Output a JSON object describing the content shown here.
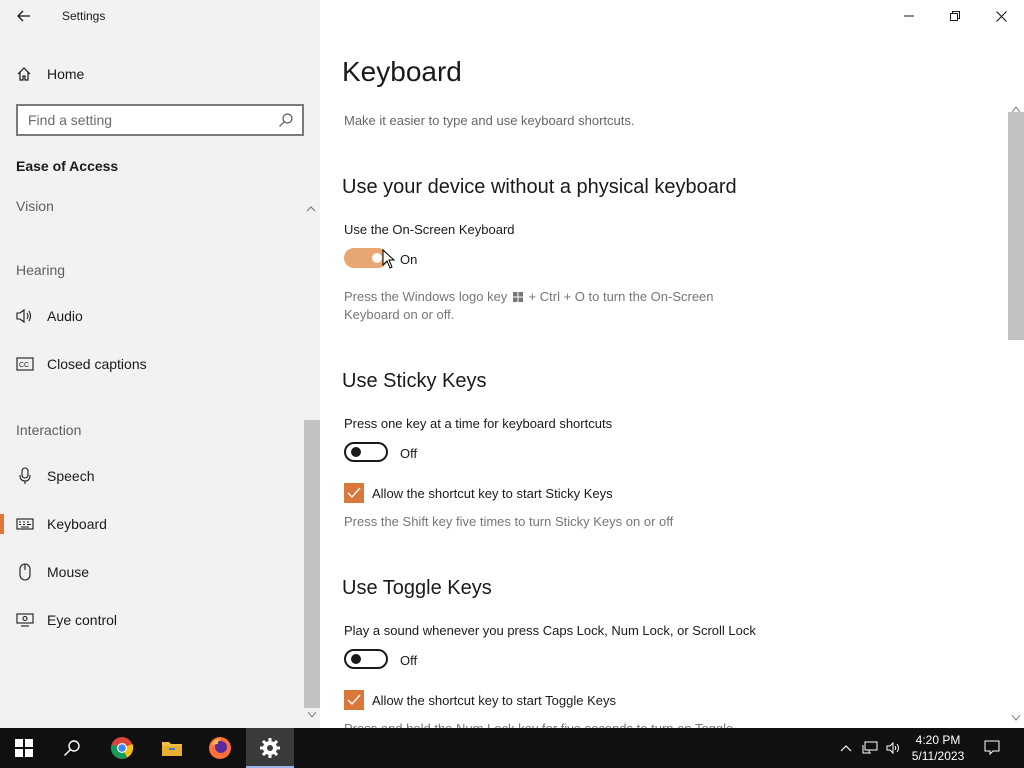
{
  "app": {
    "title": "Settings"
  },
  "sidebar": {
    "home_label": "Home",
    "search_placeholder": "Find a setting",
    "section_title": "Ease of Access",
    "groups": {
      "vision": "Vision",
      "hearing": "Hearing",
      "interaction": "Interaction"
    },
    "items": {
      "audio": "Audio",
      "closed_captions": "Closed captions",
      "speech": "Speech",
      "keyboard": "Keyboard",
      "mouse": "Mouse",
      "eye_control": "Eye control"
    },
    "active_item": "Keyboard"
  },
  "main": {
    "page_title": "Keyboard",
    "description": "Make it easier to type and use keyboard shortcuts.",
    "sections": {
      "osk": {
        "heading": "Use your device without a physical keyboard",
        "label": "Use the On-Screen Keyboard",
        "state": "On",
        "note_prefix": "Press the Windows logo key",
        "note_suffix": "+ Ctrl + O to turn the On-Screen Keyboard on or off."
      },
      "sticky": {
        "heading": "Use Sticky Keys",
        "label": "Press one key at a time for keyboard shortcuts",
        "state": "Off",
        "checkbox_label": "Allow the shortcut key to start Sticky Keys",
        "note": "Press the Shift key five times to turn Sticky Keys on or off"
      },
      "toggle": {
        "heading": "Use Toggle Keys",
        "label": "Play a sound whenever you press Caps Lock, Num Lock, or Scroll Lock",
        "state": "Off",
        "checkbox_label": "Allow the shortcut key to start Toggle Keys",
        "note": "Press and hold the Num Lock key for five seconds to turn on Toggle"
      }
    }
  },
  "taskbar": {
    "time": "4:20 PM",
    "date": "5/11/2023"
  },
  "colors": {
    "accent": "#e0763a",
    "toggle_on": "#e8a673",
    "checkbox": "#d8783a",
    "taskbar": "#101010"
  },
  "icons": {
    "back": "back-arrow-icon",
    "home": "home-icon",
    "search": "search-icon",
    "audio": "speaker-icon",
    "captions": "closed-captions-icon",
    "speech": "microphone-icon",
    "keyboard": "keyboard-icon",
    "mouse": "mouse-icon",
    "eye": "eye-control-icon"
  }
}
